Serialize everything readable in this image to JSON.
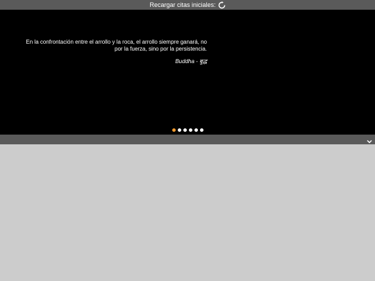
{
  "topbar": {
    "reload_label": "Recargar citas iniciales:",
    "reload_icon": "refresh-icon"
  },
  "slider": {
    "quote": "En la confrontación entre el arrollo y la roca, el arrollo siempre ganará, no por la fuerza, sino por la persistencia.",
    "author": "Buddha - बुद्ध",
    "dots_total": 6,
    "active_dot": 1,
    "active_color": "#f09a2e"
  },
  "bottombar": {
    "expand_icon": "chevron-down-icon"
  }
}
